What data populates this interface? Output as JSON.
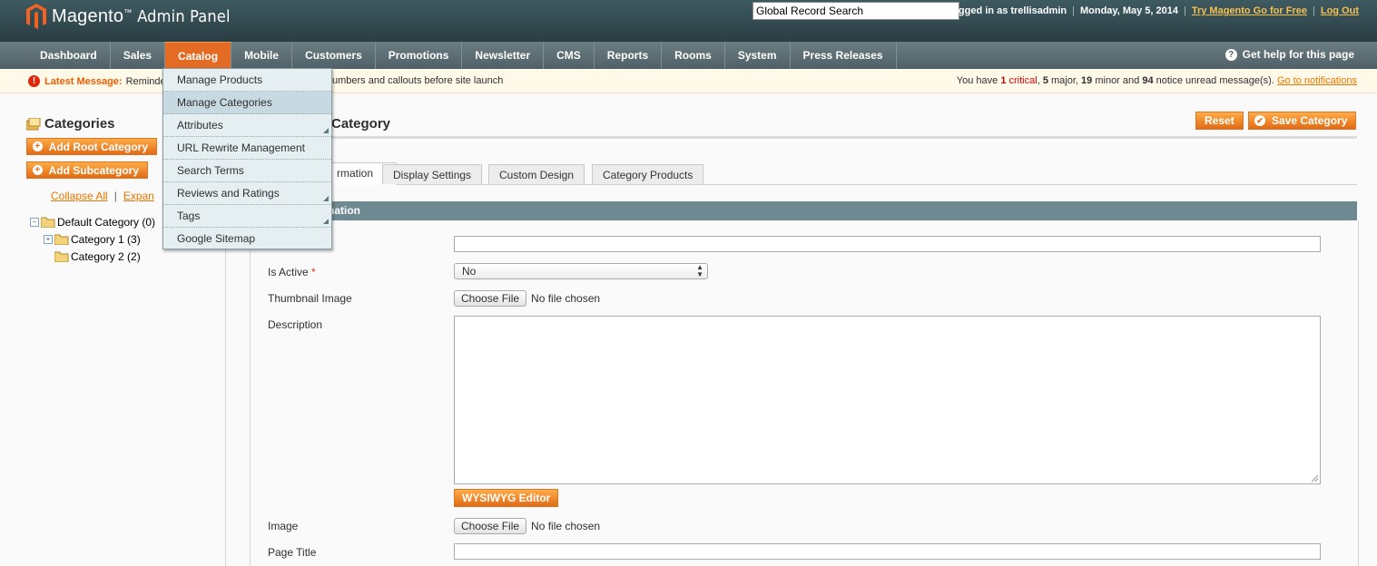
{
  "header": {
    "brand": "Magento",
    "brand_suffix": "Admin Panel",
    "search_value": "Global Record Search",
    "logged_in": "Logged in as trellisadmin",
    "date": "Monday, May 5, 2014",
    "try_link": "Try Magento Go for Free",
    "logout": "Log Out"
  },
  "nav": {
    "items": [
      {
        "label": "Dashboard"
      },
      {
        "label": "Sales"
      },
      {
        "label": "Catalog"
      },
      {
        "label": "Mobile"
      },
      {
        "label": "Customers"
      },
      {
        "label": "Promotions"
      },
      {
        "label": "Newsletter"
      },
      {
        "label": "CMS"
      },
      {
        "label": "Reports"
      },
      {
        "label": "Rooms"
      },
      {
        "label": "System"
      },
      {
        "label": "Press Releases"
      }
    ],
    "active_index": 2,
    "help": "Get help for this page"
  },
  "catalog_menu": {
    "items": [
      {
        "label": "Manage Products",
        "has_submenu": false
      },
      {
        "label": "Manage Categories",
        "has_submenu": false
      },
      {
        "label": "Attributes",
        "has_submenu": true
      },
      {
        "label": "URL Rewrite Management",
        "has_submenu": false
      },
      {
        "label": "Search Terms",
        "has_submenu": false
      },
      {
        "label": "Reviews and Ratings",
        "has_submenu": true
      },
      {
        "label": "Tags",
        "has_submenu": true
      },
      {
        "label": "Google Sitemap",
        "has_submenu": false
      }
    ],
    "highlighted_index": 1
  },
  "message_bar": {
    "label": "Latest Message:",
    "text_visible_start": "Reminde",
    "text_visible_end": "umbers and callouts before site launch",
    "notice_prefix": "You have",
    "critical_count": "1",
    "critical_word": "critical",
    "major": "5",
    "major_word": "major,",
    "minor": "19",
    "minor_word": "minor and",
    "notice": "94",
    "notice_word": "notice unread message(s).",
    "link": "Go to notifications"
  },
  "sidebar": {
    "title": "Categories",
    "add_root": "Add Root Category",
    "add_sub": "Add Subcategory",
    "collapse_all": "Collapse All",
    "expand_all": "Expan",
    "separator": "|",
    "tree": [
      {
        "label": "Default Category (0)"
      },
      {
        "label": "Category 1 (3)"
      },
      {
        "label": "Category 2 (2)"
      }
    ]
  },
  "main": {
    "title_visible": "Category",
    "reset": "Reset",
    "save": "Save Category",
    "tabs": [
      {
        "label": "rmation"
      },
      {
        "label": "Display Settings"
      },
      {
        "label": "Custom Design"
      },
      {
        "label": "Category Products"
      }
    ],
    "section_title_visible": "nation",
    "fields": {
      "is_active_label": "Is Active",
      "is_active_value": "No",
      "thumbnail_label": "Thumbnail Image",
      "choose_file": "Choose File",
      "no_file": "No file chosen",
      "description_label": "Description",
      "wysiwyg": "WYSIWYG Editor",
      "image_label": "Image",
      "page_title_label": "Page Title"
    }
  },
  "colors": {
    "accent": "#e36b23",
    "header_bg": "#2f464c",
    "section_bar": "#6f8992"
  }
}
